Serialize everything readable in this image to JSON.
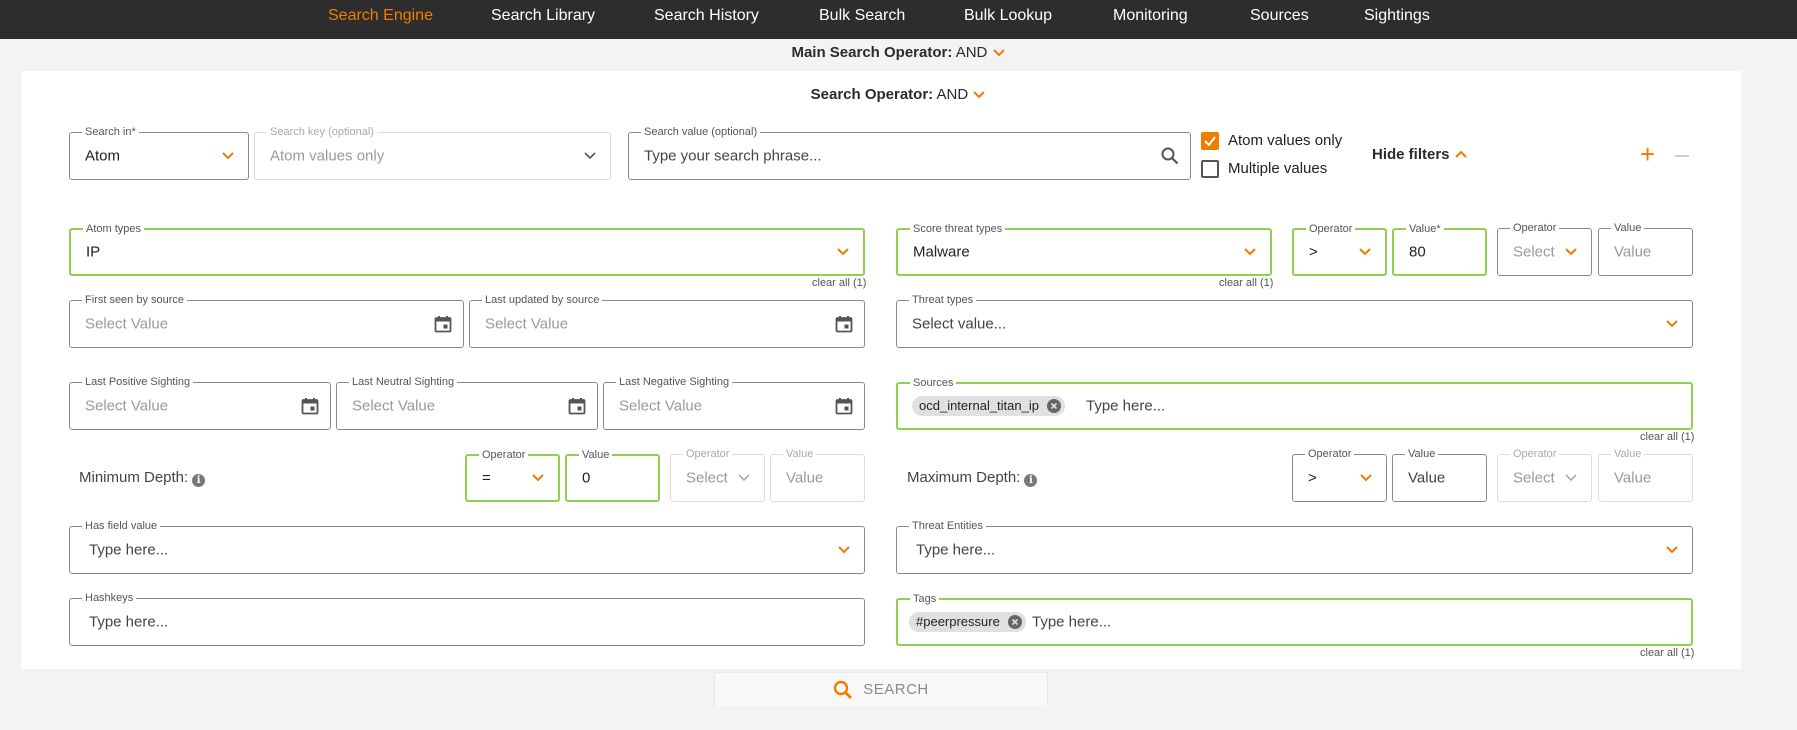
{
  "nav": {
    "items": [
      "Search Engine",
      "Search Library",
      "Search History",
      "Bulk Search",
      "Bulk Lookup",
      "Monitoring",
      "Sources",
      "Sightings"
    ],
    "active": "Search Engine"
  },
  "main_operator": {
    "label": "Main Search Operator:",
    "value": "AND"
  },
  "search_operator": {
    "label": "Search Operator:",
    "value": "AND"
  },
  "search_in": {
    "label": "Search in*",
    "value": "Atom"
  },
  "search_key": {
    "label": "Search key (optional)",
    "value": "Atom values only"
  },
  "search_value": {
    "label": "Search value (optional)",
    "placeholder": "Type your search phrase..."
  },
  "checkboxes": {
    "atom_values_only": {
      "label": "Atom values only",
      "checked": true
    },
    "multiple_values": {
      "label": "Multiple values",
      "checked": false
    }
  },
  "hide_filters_label": "Hide filters",
  "atom_types": {
    "label": "Atom types",
    "value": "IP",
    "clear": "clear all (1)"
  },
  "score_threat_types": {
    "label": "Score threat types",
    "value": "Malware",
    "clear": "clear all (1)"
  },
  "score_operator1": {
    "label": "Operator",
    "value": ">"
  },
  "score_value1": {
    "label": "Value*",
    "value": "80"
  },
  "score_operator2": {
    "label": "Operator",
    "value": "Select"
  },
  "score_value2": {
    "label": "Value",
    "value": "Value"
  },
  "first_seen": {
    "label": "First seen by source",
    "placeholder": "Select Value"
  },
  "last_updated": {
    "label": "Last updated by source",
    "placeholder": "Select Value"
  },
  "threat_types": {
    "label": "Threat types",
    "placeholder": "Select value..."
  },
  "last_positive": {
    "label": "Last Positive Sighting",
    "placeholder": "Select Value"
  },
  "last_neutral": {
    "label": "Last Neutral Sighting",
    "placeholder": "Select Value"
  },
  "last_negative": {
    "label": "Last Negative Sighting",
    "placeholder": "Select Value"
  },
  "sources": {
    "label": "Sources",
    "chip": "ocd_internal_titan_ip",
    "placeholder": "Type here...",
    "clear": "clear all (1)"
  },
  "min_depth": {
    "label": "Minimum Depth:",
    "op1": {
      "label": "Operator",
      "value": "="
    },
    "val1": {
      "label": "Value",
      "value": "0"
    },
    "op2": {
      "label": "Operator",
      "value": "Select"
    },
    "val2": {
      "label": "Value",
      "value": "Value"
    }
  },
  "max_depth": {
    "label": "Maximum Depth:",
    "op1": {
      "label": "Operator",
      "value": ">"
    },
    "val1": {
      "label": "Value",
      "value": "Value"
    },
    "op2": {
      "label": "Operator",
      "value": "Select"
    },
    "val2": {
      "label": "Value",
      "value": "Value"
    }
  },
  "has_field_value": {
    "label": "Has field value",
    "placeholder": "Type here..."
  },
  "threat_entities": {
    "label": "Threat Entities",
    "placeholder": "Type here..."
  },
  "hashkeys": {
    "label": "Hashkeys",
    "placeholder": "Type here..."
  },
  "tags": {
    "label": "Tags",
    "chip": "#peerpressure",
    "placeholder": "Type here...",
    "clear": "clear all (1)"
  },
  "search_button": "SEARCH",
  "colors": {
    "accent": "#f07c00",
    "nav_bg": "#2d2d2d",
    "valid_border": "#8fd14f"
  }
}
